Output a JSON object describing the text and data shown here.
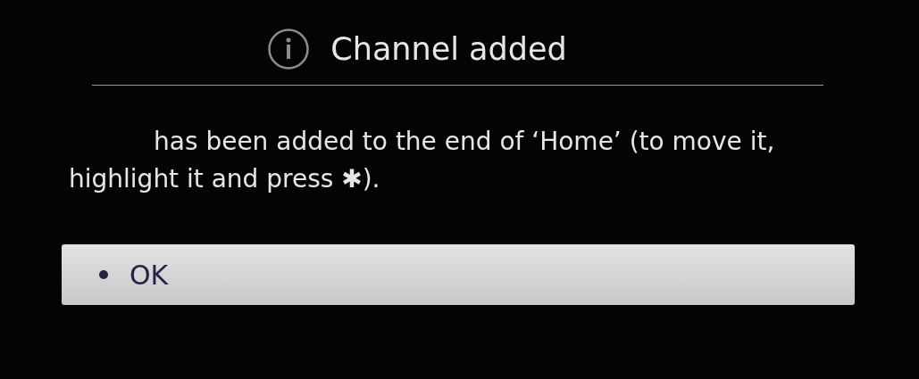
{
  "dialog": {
    "title": "Channel added",
    "message": "has been added to the end of ‘Home’ (to move it, highlight it and press ✱).",
    "buttons": [
      {
        "label": "OK",
        "selected": true
      }
    ]
  }
}
